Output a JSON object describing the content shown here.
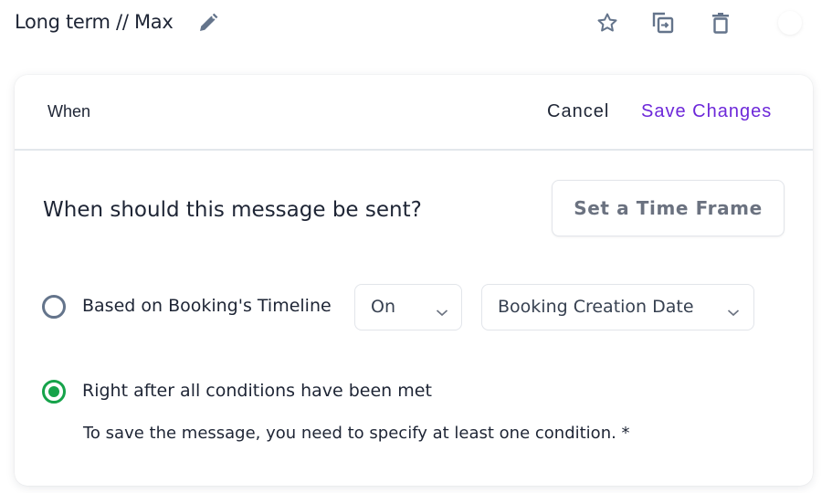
{
  "header": {
    "title": "Long term // Max",
    "icons": [
      "edit-icon",
      "star-icon",
      "duplicate-icon",
      "trash-icon",
      "toggle-switch"
    ]
  },
  "card": {
    "section_label": "When",
    "cancel_label": "Cancel",
    "save_label": "Save Changes",
    "question": "When should this message be sent?",
    "timeframe_button": "Set a Time Frame",
    "options": [
      {
        "label": "Based on Booking's Timeline",
        "selected": false,
        "relation_select": "On",
        "date_select": "Booking Creation Date"
      },
      {
        "label": "Right after all conditions have been met",
        "selected": true
      }
    ],
    "hint": "To save the message, you need to specify at least one condition. *"
  },
  "colors": {
    "accent": "#6d28d9",
    "selected_radio": "#16a34a",
    "icon": "#64748b"
  }
}
